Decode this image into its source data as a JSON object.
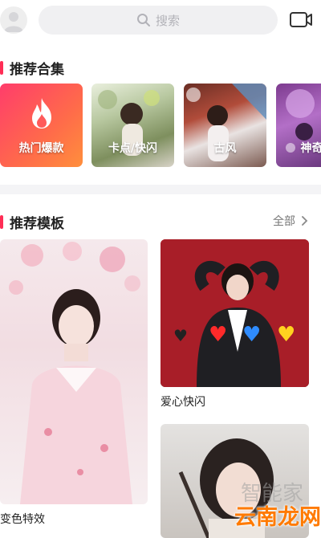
{
  "search": {
    "placeholder": "搜索"
  },
  "recommended_collections": {
    "title": "推荐合集",
    "items": [
      {
        "label": "热门爆款"
      },
      {
        "label": "卡点/快闪"
      },
      {
        "label": "古风"
      },
      {
        "label": "神奇特"
      }
    ]
  },
  "recommended_templates": {
    "title": "推荐模板",
    "see_all": "全部",
    "items": [
      {
        "label": "变色特效"
      },
      {
        "label": "爱心快闪"
      },
      {
        "label": ""
      }
    ]
  },
  "watermark": {
    "text": "云南龙网",
    "ghost_text": "智能家"
  },
  "colors": {
    "accent": "#ff2d55",
    "hot_gradient_start": "#ff3d6b",
    "hot_gradient_end": "#ff8f3c"
  },
  "icons": [
    "avatar-icon",
    "search-icon",
    "camera-icon",
    "flame-icon",
    "chevron-right-icon"
  ]
}
